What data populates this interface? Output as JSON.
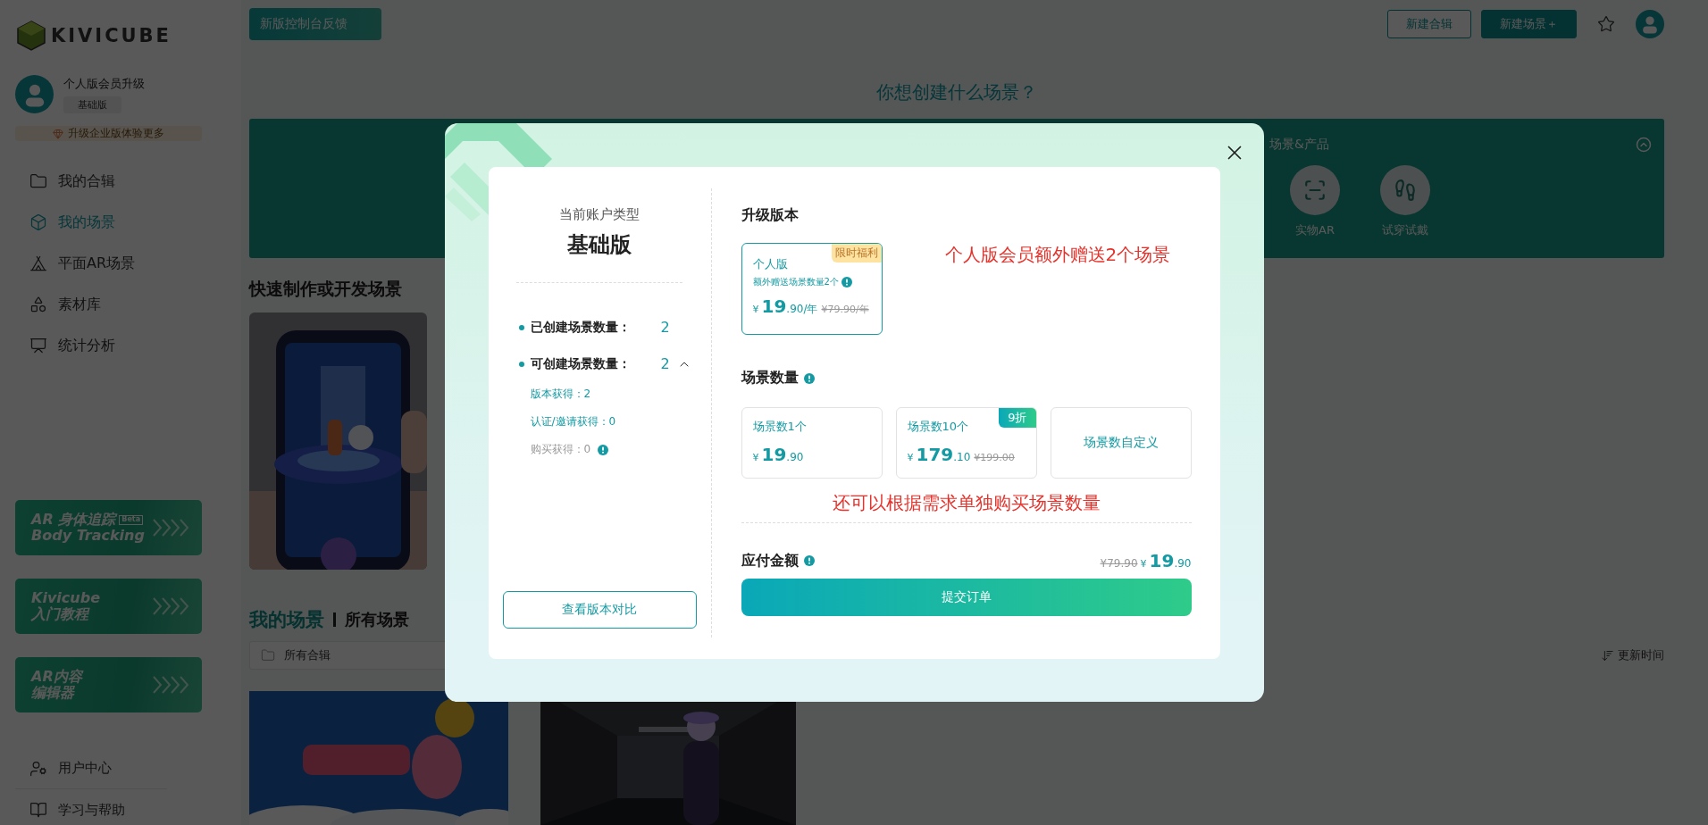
{
  "sidebar": {
    "logo": "KIVICUBE",
    "profile": {
      "title": "个人版会员升级",
      "plan_badge": "基础版"
    },
    "upgrade": "升级企业版体验更多",
    "nav": [
      {
        "label": "我的合辑",
        "selected": false
      },
      {
        "label": "我的场景",
        "selected": true
      },
      {
        "label": "平面AR场景",
        "selected": false
      },
      {
        "label": "素材库",
        "selected": false
      },
      {
        "label": "统计分析",
        "selected": false
      }
    ],
    "promos": [
      {
        "title": "AR 身体追踪",
        "tag": "Beta",
        "subtitle": "Body Tracking"
      },
      {
        "title": "Kivicube",
        "subtitle": "入门教程"
      },
      {
        "title": "AR内容",
        "subtitle": "编辑器"
      }
    ],
    "footer": [
      {
        "label": "用户中心"
      },
      {
        "label": "学习与帮助"
      }
    ]
  },
  "topbar": {
    "feedback": "新版控制台反馈",
    "buttons": [
      {
        "label": "新建合辑",
        "kind": "outline"
      },
      {
        "label": "新建场景＋",
        "kind": "filled"
      }
    ]
  },
  "create": {
    "heading": "你想创建什么场景？",
    "panel": {
      "title": "场景&产品",
      "expanded": true,
      "items": [
        "实物AR",
        "试穿试戴"
      ]
    }
  },
  "quick": {
    "heading": "快速制作或开发场景"
  },
  "scenes": {
    "tabs": [
      {
        "label": "我的场景",
        "selected": true
      },
      {
        "label": "所有场景",
        "selected": false
      }
    ],
    "filter": "所有合辑",
    "sort": "更新时间"
  },
  "modal": {
    "account": {
      "caption": "当前账户类型",
      "plan": "基础版",
      "stats": [
        {
          "label": "已创建场景数量：",
          "value": "2"
        },
        {
          "label": "可创建场景数量：",
          "value": "2",
          "expanded": true,
          "children": [
            {
              "label": "版本获得：2",
              "kind": "earned"
            },
            {
              "label": "认证/邀请获得：0",
              "kind": "earned"
            },
            {
              "label": "购买获得：0",
              "kind": "purchase"
            }
          ]
        }
      ],
      "compare_button": "查看版本对比"
    },
    "upgrade": {
      "heading": "升级版本",
      "plans": [
        {
          "selected": true,
          "badge": "限时福利",
          "name": "个人版",
          "note": "额外赠送场景数量2个",
          "price": {
            "currency": "¥",
            "integer": "19",
            "decimal": ".90/年"
          },
          "original": "¥79.90/年"
        }
      ],
      "annotation": "个人版会员额外赠送2个场景"
    },
    "quantity": {
      "heading": "场景数量",
      "options": [
        {
          "kind": "price",
          "selected": false,
          "label": "场景数1个",
          "price": {
            "currency": "¥",
            "integer": "19",
            "decimal": ".90"
          }
        },
        {
          "kind": "price",
          "selected": false,
          "label": "场景数10个",
          "badge": "9折",
          "price": {
            "currency": "¥",
            "integer": "179",
            "decimal": ".10"
          },
          "original": "¥199.00"
        },
        {
          "kind": "custom",
          "selected": false,
          "label": "场景数自定义"
        }
      ],
      "annotation": "还可以根据需求单独购买场景数量"
    },
    "total": {
      "label": "应付金额",
      "original": "¥79.90",
      "price": {
        "currency": "¥",
        "integer": "19",
        "decimal": ".90"
      }
    },
    "submit": "提交订单"
  }
}
